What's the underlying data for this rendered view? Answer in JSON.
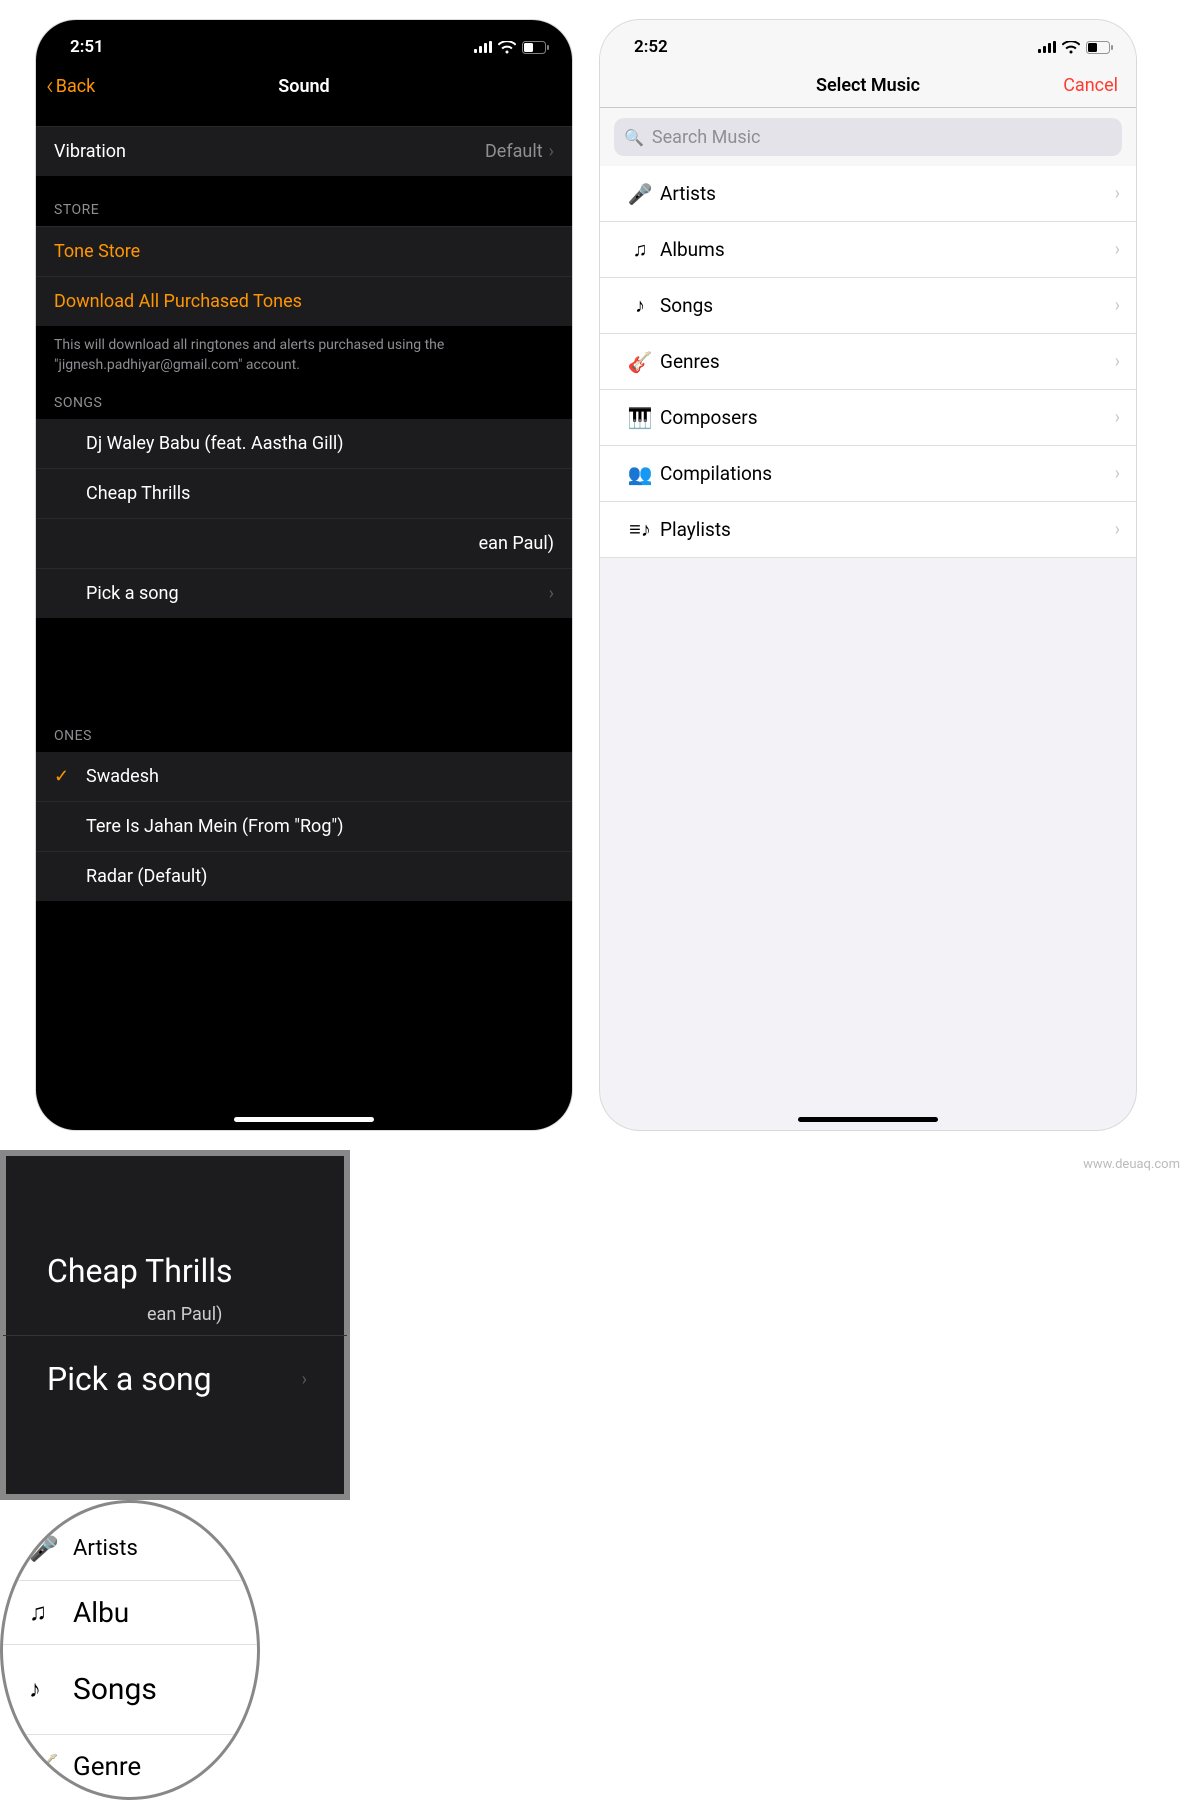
{
  "left": {
    "status_time": "2:51",
    "nav_back": "Back",
    "nav_title": "Sound",
    "vibration_label": "Vibration",
    "vibration_value": "Default",
    "store_header": "STORE",
    "tone_store": "Tone Store",
    "download_all": "Download All Purchased Tones",
    "download_footer": "This will download all ringtones and alerts purchased using the \"jignesh.padhiyar@gmail.com\" account.",
    "songs_header": "SONGS",
    "songs": {
      "s0": "Dj Waley Babu (feat. Aastha Gill)",
      "s1": "Cheap Thrills",
      "s2_suffix": "ean Paul)",
      "pick": "Pick a song"
    },
    "ringtones_header": "ONES",
    "ringtones": {
      "r0": "Swadesh",
      "r1": "Tere Is Jahan Mein (From \"Rog\")",
      "r2": "Radar (Default)"
    }
  },
  "right": {
    "status_time": "2:52",
    "nav_title": "Select Music",
    "nav_cancel": "Cancel",
    "search_placeholder": "Search Music",
    "rows": {
      "artists": "Artists",
      "albums": "Albums",
      "songs": "Songs",
      "genres": "Genres",
      "composers": "Composers",
      "compilations": "Compilations",
      "playlists": "Playlists"
    },
    "callout": {
      "top": "Artists",
      "albums": "Albu",
      "songs": "Songs",
      "genres": "Genre"
    }
  },
  "watermark": "www.deuaq.com"
}
